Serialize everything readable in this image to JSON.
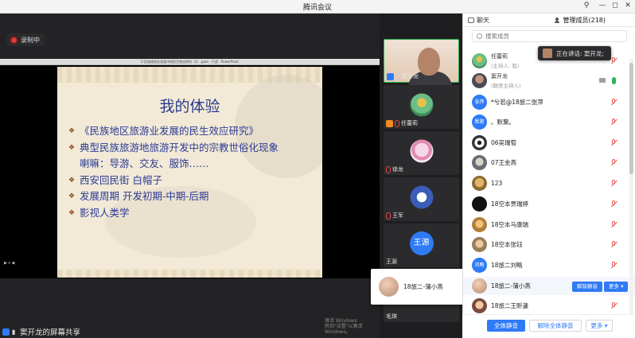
{
  "window": {
    "title": "腾讯会议"
  },
  "window_controls": {
    "pin": "⚲",
    "minimize": "—",
    "maximize": "◻",
    "close": "✕"
  },
  "recording": {
    "label": "录制中"
  },
  "share": {
    "doc_caption": "2-民族旅游业发展中的民生效应研究（1）.pptx - 只读 - PowerPoint",
    "slide_title": "我的体验",
    "bullets": [
      "《民族地区旅游业发展的民生效应研究》",
      "典型民族旅游地旅游开发中的宗教世俗化现象",
      "喇嘛：导游、交友、服饰……",
      "西安回民街 白帽子",
      "发展周期 开发初期-中期-后期",
      "影视人类学"
    ],
    "activate_text_1": "激活 Windows",
    "activate_text_2": "转到\"设置\"以激活 Windows。",
    "left_ctrl": "▶ ⏸ ◀"
  },
  "sharer": {
    "label": "窦开龙的屏幕共享"
  },
  "videos": [
    {
      "name": "窦开龙"
    },
    {
      "name": "任蕾莉"
    },
    {
      "name": "徐龙"
    },
    {
      "name": "王军"
    },
    {
      "name": "王源",
      "avatar_text": "王源"
    },
    {
      "name": "毛琪"
    }
  ],
  "float_card": {
    "name": "18旅二-蒲小燕"
  },
  "panel": {
    "tab_chat": "聊天",
    "tab_members": "管理成员(218)",
    "search_placeholder": "搜索成员",
    "members": [
      {
        "name": "任蕾莉",
        "sub": "(主持人, 我)"
      },
      {
        "name": "窦开龙",
        "sub": "(联席主持人)"
      },
      {
        "name": "*兮若@18旅二张萍",
        "avatar_text": "张萍"
      },
      {
        "name": "。默黧。",
        "avatar_text": "默黧"
      },
      {
        "name": "06吴瑞萄"
      },
      {
        "name": "07王金燕"
      },
      {
        "name": "123"
      },
      {
        "name": "18空本贾瑞婷"
      },
      {
        "name": "18空本马康瑞"
      },
      {
        "name": "18空本张钰"
      },
      {
        "name": "18旅二刘略",
        "avatar_text": "刘略"
      },
      {
        "name": "18旅二-蒲小燕"
      },
      {
        "name": "18旅二王昕蘧"
      }
    ],
    "row_btn_unmute": "解除静音",
    "row_btn_more": "更多 ▾",
    "speaking_text": "正在讲话: 窦开龙;"
  },
  "bottom": {
    "mute_all": "全体静音",
    "unmute_all": "解除全体静音",
    "more": "更多 ▾"
  }
}
